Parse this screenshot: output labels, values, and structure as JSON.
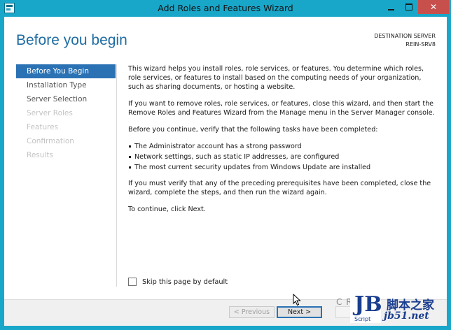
{
  "window": {
    "title": "Add Roles and Features Wizard",
    "controls": {
      "minimize": "minimize-icon",
      "maximize": "maximize-icon",
      "close": "✕"
    }
  },
  "header": {
    "page_title": "Before you begin",
    "destination_label": "DESTINATION SERVER",
    "destination_server": "REIN-SRV8"
  },
  "nav": {
    "items": [
      {
        "label": "Before You Begin",
        "state": "active"
      },
      {
        "label": "Installation Type",
        "state": "enabled"
      },
      {
        "label": "Server Selection",
        "state": "enabled"
      },
      {
        "label": "Server Roles",
        "state": "disabled"
      },
      {
        "label": "Features",
        "state": "disabled"
      },
      {
        "label": "Confirmation",
        "state": "disabled"
      },
      {
        "label": "Results",
        "state": "disabled"
      }
    ]
  },
  "content": {
    "p1": "This wizard helps you install roles, role services, or features. You determine which roles, role services, or features to install based on the computing needs of your organization, such as sharing documents, or hosting a website.",
    "p2": "If you want to remove roles, role services, or features, close this wizard, and then start the Remove Roles and Features Wizard from the Manage menu in the Server Manager console.",
    "p3": "Before you continue, verify that the following tasks have been completed:",
    "bullets": [
      "The Administrator account has a strong password",
      "Network settings, such as static IP addresses, are configured",
      "The most current security updates from Windows Update are installed"
    ],
    "p4": "If you must verify that any of the preceding prerequisites have been completed, close the wizard, complete the steps, and then run the wizard again.",
    "p5": "To continue, click Next."
  },
  "skip_checkbox": {
    "label": "Skip this page by default",
    "checked": false
  },
  "footer": {
    "previous_label": "< Previous",
    "next_label": "Next >",
    "overlay_text": "C  R"
  },
  "watermark": {
    "logo_letters": "JB",
    "logo_sub": "Script",
    "site_name": "脚本之家",
    "site_url": "jb51.net"
  },
  "colors": {
    "frame": "#19a7c9",
    "accent": "#2b72b4",
    "title": "#1e6ca3",
    "close": "#c7504c"
  }
}
